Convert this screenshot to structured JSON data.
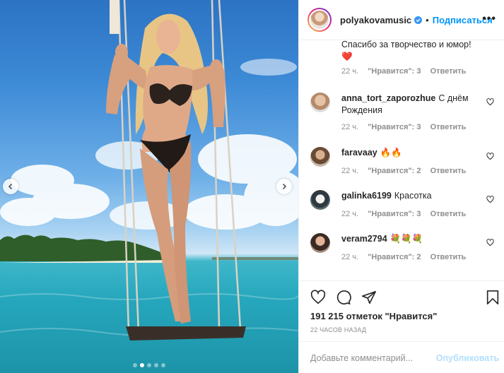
{
  "post": {
    "username": "polyakovamusic",
    "separator": "•",
    "follow_label": "Подписаться",
    "more_label": "•••"
  },
  "comments": [
    {
      "user": "",
      "text": "Спасибо за творчество и юмор!",
      "emoji": "❤️",
      "time": "22 ч.",
      "likes": "\"Нравится\": 3",
      "reply": "Ответить"
    },
    {
      "user": "anna_tort_zaporozhue",
      "text": "С днём Рождения",
      "time": "22 ч.",
      "likes": "\"Нравится\": 3",
      "reply": "Ответить"
    },
    {
      "user": "faravaay",
      "text": "🔥🔥",
      "time": "22 ч.",
      "likes": "\"Нравится\": 2",
      "reply": "Ответить"
    },
    {
      "user": "galinka6199",
      "text": "Красотка",
      "time": "22 ч.",
      "likes": "\"Нравится\": 3",
      "reply": "Ответить"
    },
    {
      "user": "veram2794",
      "text": "💐💐💐",
      "time": "22 ч.",
      "likes": "\"Нравится\": 2",
      "reply": "Ответить"
    }
  ],
  "likes_count": "191 215 отметок \"Нравится\"",
  "posted_time": "22 ЧАСОВ НАЗАД",
  "comment_placeholder": "Добавьте комментарий...",
  "publish_label": "Опубликовать",
  "carousel": {
    "total": 5,
    "active": 1
  },
  "colors": {
    "accent": "#0095f6",
    "publish_disabled": "#b2dffc",
    "meta": "#8e8e8e",
    "heart": "#ed4956"
  }
}
